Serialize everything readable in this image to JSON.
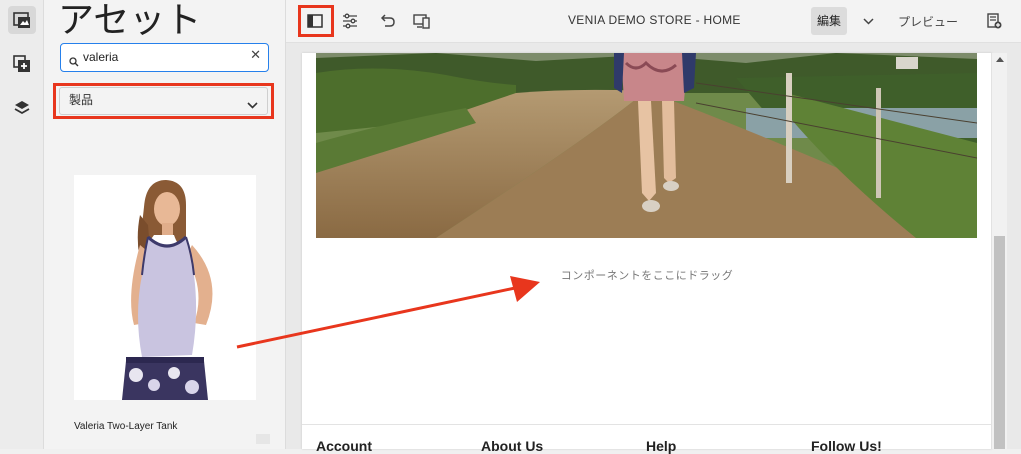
{
  "side_rail": {
    "items": [
      {
        "icon": "asset-finder-icon",
        "active": true
      },
      {
        "icon": "add-component-icon",
        "active": false
      },
      {
        "icon": "layers-icon",
        "active": false
      }
    ]
  },
  "panel": {
    "title": "アセット",
    "search": {
      "value": "valeria",
      "placeholder": ""
    },
    "asset_type": "製品",
    "assets": [
      {
        "label": "Valeria Two-Layer Tank"
      }
    ]
  },
  "toolbar": {
    "page_title": "VENIA DEMO STORE - HOME",
    "mode": "編集",
    "preview_label": "プレビュー"
  },
  "editor": {
    "dropzone_text": "コンポーネントをここにドラッグ",
    "footer_columns": [
      "Account",
      "About Us",
      "Help",
      "Follow Us!"
    ]
  },
  "colors": {
    "highlight": "#e8361d",
    "accent": "#2680eb"
  }
}
